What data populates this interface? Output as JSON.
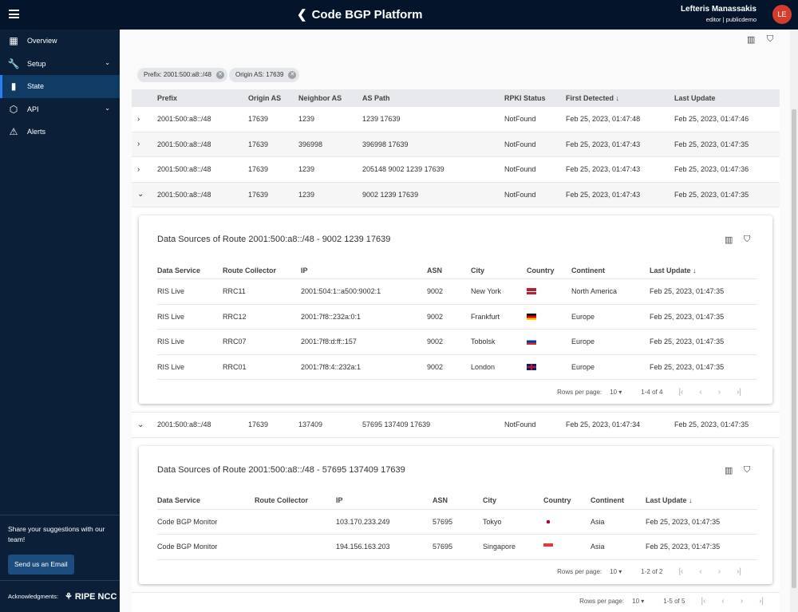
{
  "header": {
    "title": "Code BGP Platform",
    "user_name": "Lefteris Manassakis",
    "user_role": "editor | publicdemo",
    "avatar": "LE"
  },
  "sidebar": {
    "items": [
      {
        "label": "Overview",
        "icon": "dashboard-icon"
      },
      {
        "label": "Setup",
        "icon": "wrench-icon",
        "expandable": true
      },
      {
        "label": "State",
        "icon": "bar-chart-icon",
        "active": true
      },
      {
        "label": "API",
        "icon": "api-icon",
        "expandable": true
      },
      {
        "label": "Alerts",
        "icon": "warning-icon"
      }
    ],
    "share_text": "Share your suggestions with our team!",
    "email_button": "Send us an Email",
    "ack_label": "Acknowledgments:",
    "ack_logo": "RIPE NCC"
  },
  "filters": [
    {
      "label": "Prefix: 2001:500:a8::/48"
    },
    {
      "label": "Origin AS: 17639"
    }
  ],
  "table": {
    "columns": [
      "Prefix",
      "Origin AS",
      "Neighbor AS",
      "AS Path",
      "RPKI Status",
      "First Detected ↓",
      "Last Update"
    ],
    "rows": [
      {
        "expanded": false,
        "cells": [
          "2001:500:a8::/48",
          "17639",
          "1239",
          "1239   17639",
          "NotFound",
          "Feb 25, 2023, 01:47:48",
          "Feb 25, 2023, 01:47:46"
        ]
      },
      {
        "expanded": false,
        "cells": [
          "2001:500:a8::/48",
          "17639",
          "396998",
          "396998   17639",
          "NotFound",
          "Feb 25, 2023, 01:47:43",
          "Feb 25, 2023, 01:47:35"
        ]
      },
      {
        "expanded": false,
        "cells": [
          "2001:500:a8::/48",
          "17639",
          "1239",
          "205148   9002   1239   17639",
          "NotFound",
          "Feb 25, 2023, 01:47:43",
          "Feb 25, 2023, 01:47:36"
        ]
      },
      {
        "expanded": true,
        "cells": [
          "2001:500:a8::/48",
          "17639",
          "1239",
          "9002   1239   17639",
          "NotFound",
          "Feb 25, 2023, 01:47:43",
          "Feb 25, 2023, 01:47:35"
        ],
        "detail": {
          "title": "Data Sources of Route 2001:500:a8::/48 - 9002 1239 17639",
          "columns": [
            "Data Service",
            "Route Collector",
            "IP",
            "ASN",
            "City",
            "Country",
            "Continent",
            "Last Update ↓"
          ],
          "rows": [
            [
              "RIS Live",
              "RRC11",
              "2001:504:1::a500:9002:1",
              "9002",
              "New York",
              "us",
              "North America",
              "Feb 25, 2023, 01:47:35"
            ],
            [
              "RIS Live",
              "RRC12",
              "2001:7f8::232a:0:1",
              "9002",
              "Frankfurt",
              "de",
              "Europe",
              "Feb 25, 2023, 01:47:35"
            ],
            [
              "RIS Live",
              "RRC07",
              "2001:7f8:d:ff::157",
              "9002",
              "Tobolsk",
              "ru",
              "Europe",
              "Feb 25, 2023, 01:47:35"
            ],
            [
              "RIS Live",
              "RRC01",
              "2001:7f8:4::232a:1",
              "9002",
              "London",
              "gb",
              "Europe",
              "Feb 25, 2023, 01:47:35"
            ]
          ],
          "pagination": {
            "rows_label": "Rows per page:",
            "rows_value": "10 ▾",
            "range": "1-4 of 4"
          }
        }
      },
      {
        "expanded": true,
        "cells": [
          "2001:500:a8::/48",
          "17639",
          "137409",
          "57695   137409   17639",
          "NotFound",
          "Feb 25, 2023, 01:47:34",
          "Feb 25, 2023, 01:47:35"
        ],
        "detail": {
          "title": "Data Sources of Route 2001:500:a8::/48 - 57695 137409 17639",
          "columns": [
            "Data Service",
            "Route Collector",
            "IP",
            "ASN",
            "City",
            "Country",
            "Continent",
            "Last Update ↓"
          ],
          "rows": [
            [
              "Code BGP Monitor",
              "",
              "103.170.233.249",
              "57695",
              "Tokyo",
              "jp",
              "Asia",
              "Feb 25, 2023, 01:47:35"
            ],
            [
              "Code BGP Monitor",
              "",
              "194.156.163.203",
              "57695",
              "Singapore",
              "sg",
              "Asia",
              "Feb 25, 2023, 01:47:35"
            ]
          ],
          "pagination": {
            "rows_label": "Rows per page:",
            "rows_value": "10 ▾",
            "range": "1-2 of 2"
          }
        }
      }
    ],
    "pagination": {
      "rows_label": "Rows per page:",
      "rows_value": "10 ▾",
      "range": "1-5 of 5"
    }
  },
  "colors": {
    "header": "#04152b",
    "sidebar": "#0b1f38",
    "active": "#0f3a64",
    "avatar": "#d43c2c"
  }
}
